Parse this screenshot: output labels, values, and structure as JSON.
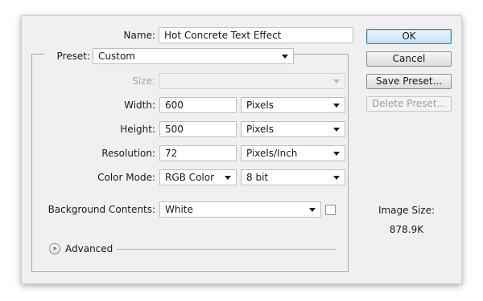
{
  "name": {
    "label": "Name:",
    "value": "Hot Concrete Text Effect"
  },
  "preset": {
    "label": "Preset:",
    "value": "Custom"
  },
  "size": {
    "label": "Size:",
    "value": ""
  },
  "width": {
    "label": "Width:",
    "value": "600",
    "unit": "Pixels"
  },
  "height": {
    "label": "Height:",
    "value": "500",
    "unit": "Pixels"
  },
  "resolution": {
    "label": "Resolution:",
    "value": "72",
    "unit": "Pixels/Inch"
  },
  "color_mode": {
    "label": "Color Mode:",
    "value": "RGB Color",
    "depth": "8 bit"
  },
  "background": {
    "label": "Background Contents:",
    "value": "White"
  },
  "advanced": {
    "label": "Advanced"
  },
  "buttons": {
    "ok": "OK",
    "cancel": "Cancel",
    "save_preset": "Save Preset...",
    "delete_preset": "Delete Preset..."
  },
  "image_size": {
    "label": "Image Size:",
    "value": "878.9K"
  }
}
